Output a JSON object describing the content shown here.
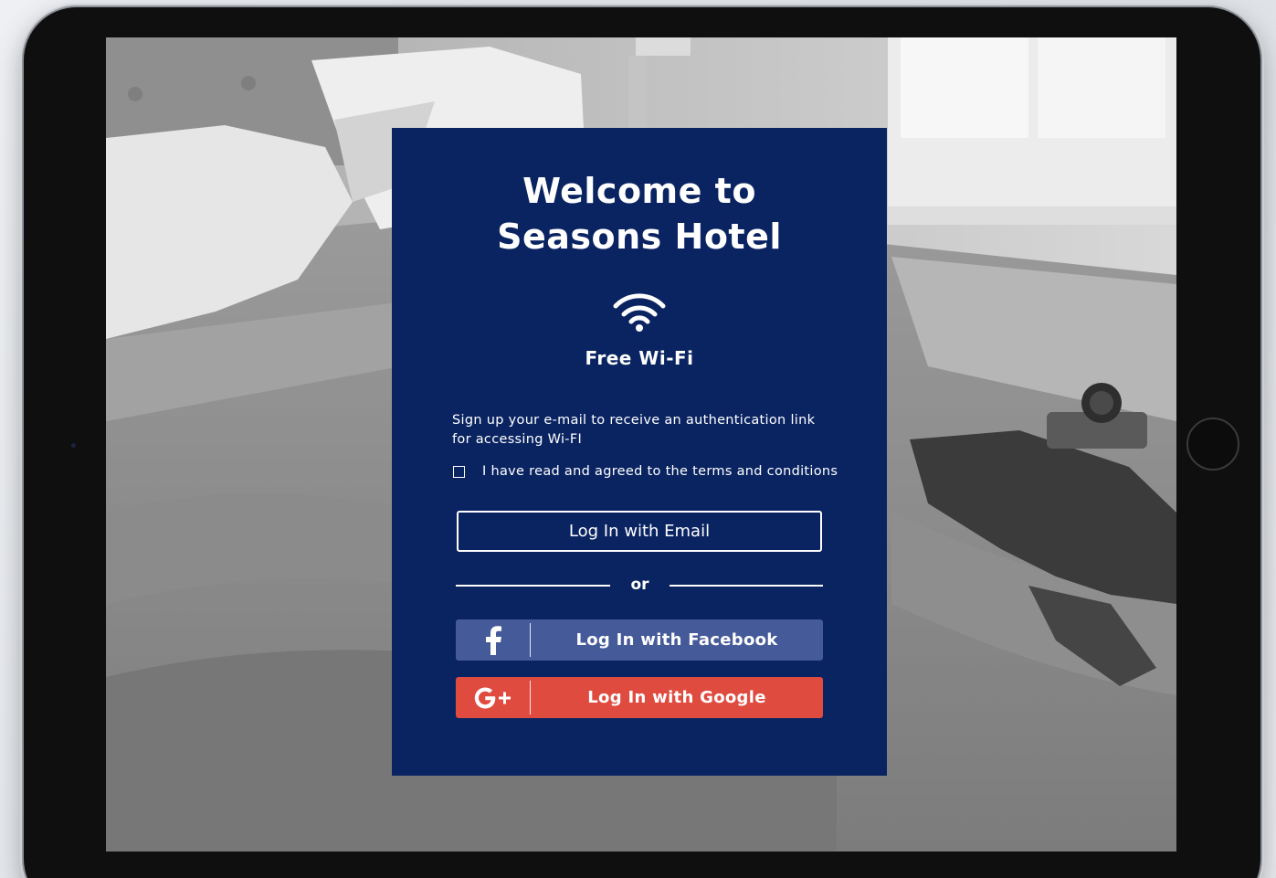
{
  "welcome": {
    "line1": "Welcome to",
    "line2": "Seasons Hotel"
  },
  "wifi": {
    "icon": "wifi-icon",
    "label": "Free Wi-Fi"
  },
  "info_text": "Sign up your e-mail to receive an authentication link for accessing Wi-FI",
  "terms": {
    "label": "I have read and agreed to the terms and conditions",
    "checked": false
  },
  "buttons": {
    "email": "Log In with Email",
    "separator": "or",
    "facebook": {
      "label": "Log In with Facebook",
      "icon": "facebook-icon",
      "color": "#455a99"
    },
    "google": {
      "label": "Log In with Google",
      "icon": "google-plus-icon",
      "color": "#e04b40"
    }
  },
  "colors": {
    "card_background": "#0a2462",
    "text": "#ffffff"
  }
}
